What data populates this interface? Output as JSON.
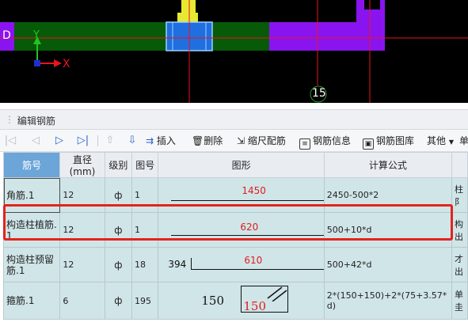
{
  "canvas": {
    "axis_x_label": "X",
    "axis_y_label": "Y",
    "side_label": "D",
    "gridline_label": "15",
    "colors": {
      "background": "#000000",
      "beam": "#075a07",
      "column": "#1f6fe0",
      "purple": "#8a14f0",
      "yellow": "#e8e833",
      "axis": "#e8141e"
    }
  },
  "panel": {
    "title": "编辑钢筋"
  },
  "toolbar": {
    "nav_icons": [
      "first-icon",
      "prev-icon",
      "next-icon",
      "last-icon"
    ],
    "insert_label": "插入",
    "delete_label": "删除",
    "scale_label": "缩尺配筋",
    "info_label": "钢筋信息",
    "library_label": "钢筋图库",
    "other_label": "其他",
    "cut_label": "单"
  },
  "table": {
    "headers": [
      "筋号",
      "直径(mm)",
      "级别",
      "图号",
      "图形",
      "计算公式",
      ""
    ],
    "rows": [
      {
        "name": "角筋.1",
        "diameter": "12",
        "grade": "ф",
        "fig": "1",
        "shape_num": "1450",
        "shape_left": "",
        "formula": "2450-500*2",
        "extra": "柱\n阝"
      },
      {
        "name": "构造柱植筋.1",
        "diameter": "12",
        "grade": "ф",
        "fig": "1",
        "shape_num": "620",
        "shape_left": "",
        "formula": "500+10*d",
        "extra": "构\n出"
      },
      {
        "name": "构造柱预留筋.1",
        "diameter": "12",
        "grade": "ф",
        "fig": "18",
        "shape_num": "610",
        "shape_left": "394",
        "formula": "500+42*d",
        "extra": "才\n出"
      },
      {
        "name": "箍筋.1",
        "diameter": "6",
        "grade": "ф",
        "fig": "195",
        "shape_num": "150",
        "shape_left": "150",
        "formula": "2*(150+150)+2*(75+3.57*d)",
        "extra": "单\n圭"
      }
    ]
  }
}
